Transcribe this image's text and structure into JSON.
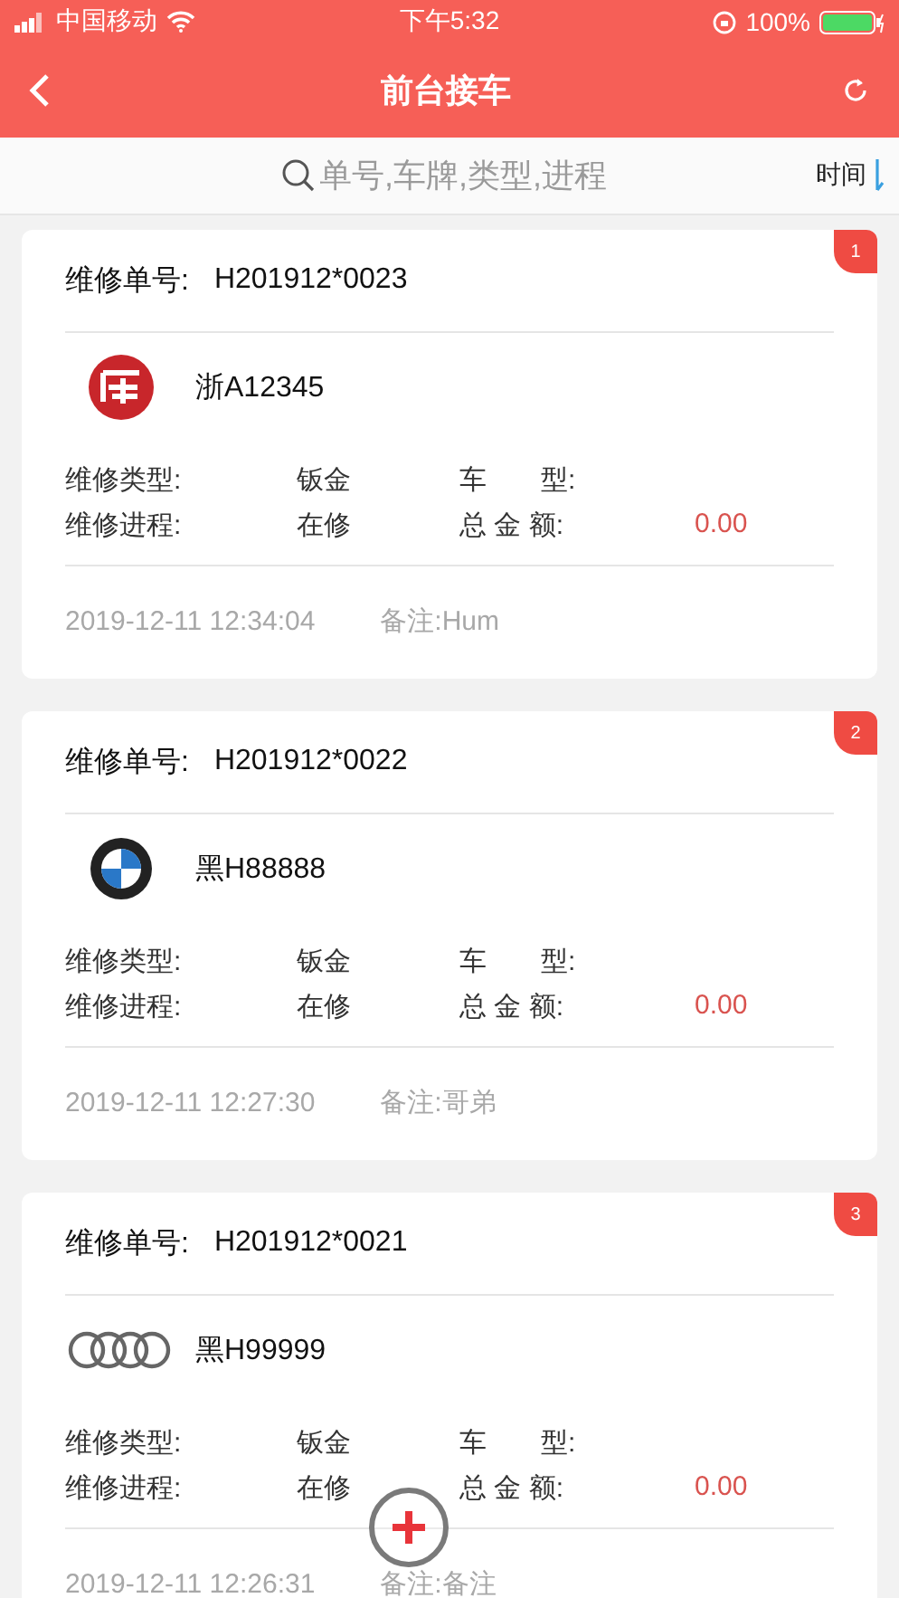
{
  "status_bar": {
    "carrier": "中国移动",
    "time": "下午5:32",
    "battery": "100%"
  },
  "nav": {
    "title": "前台接车"
  },
  "search": {
    "placeholder": "单号,车牌,类型,进程",
    "sort_label": "时间"
  },
  "orders": [
    {
      "badge": "1",
      "order_label": "维修单号:",
      "order_no": "H201912*0023",
      "kind": "seal",
      "plate": "浙A12345",
      "type_label": "维修类型:",
      "type": "钣金",
      "model_label": "车　　型:",
      "progress_label": "维修进程:",
      "progress": "在修",
      "total_label": "总 金 额:",
      "total": "0.00",
      "time": "2019-12-11 12:34:04",
      "note": "备注:Hum"
    },
    {
      "badge": "2",
      "order_label": "维修单号:",
      "order_no": "H201912*0022",
      "kind": "roundel",
      "plate": "黑H88888",
      "type_label": "维修类型:",
      "type": "钣金",
      "model_label": "车　　型:",
      "progress_label": "维修进程:",
      "progress": "在修",
      "total_label": "总 金 额:",
      "total": "0.00",
      "time": "2019-12-11 12:27:30",
      "note": "备注:哥弟"
    },
    {
      "badge": "3",
      "order_label": "维修单号:",
      "order_no": "H201912*0021",
      "kind": "rings",
      "plate": "黑H99999",
      "type_label": "维修类型:",
      "type": "钣金",
      "model_label": "车　　型:",
      "progress_label": "维修进程:",
      "progress": "在修",
      "total_label": "总 金 额:",
      "total": "0.00",
      "time": "2019-12-11 12:26:31",
      "note": "备注:备注"
    }
  ]
}
